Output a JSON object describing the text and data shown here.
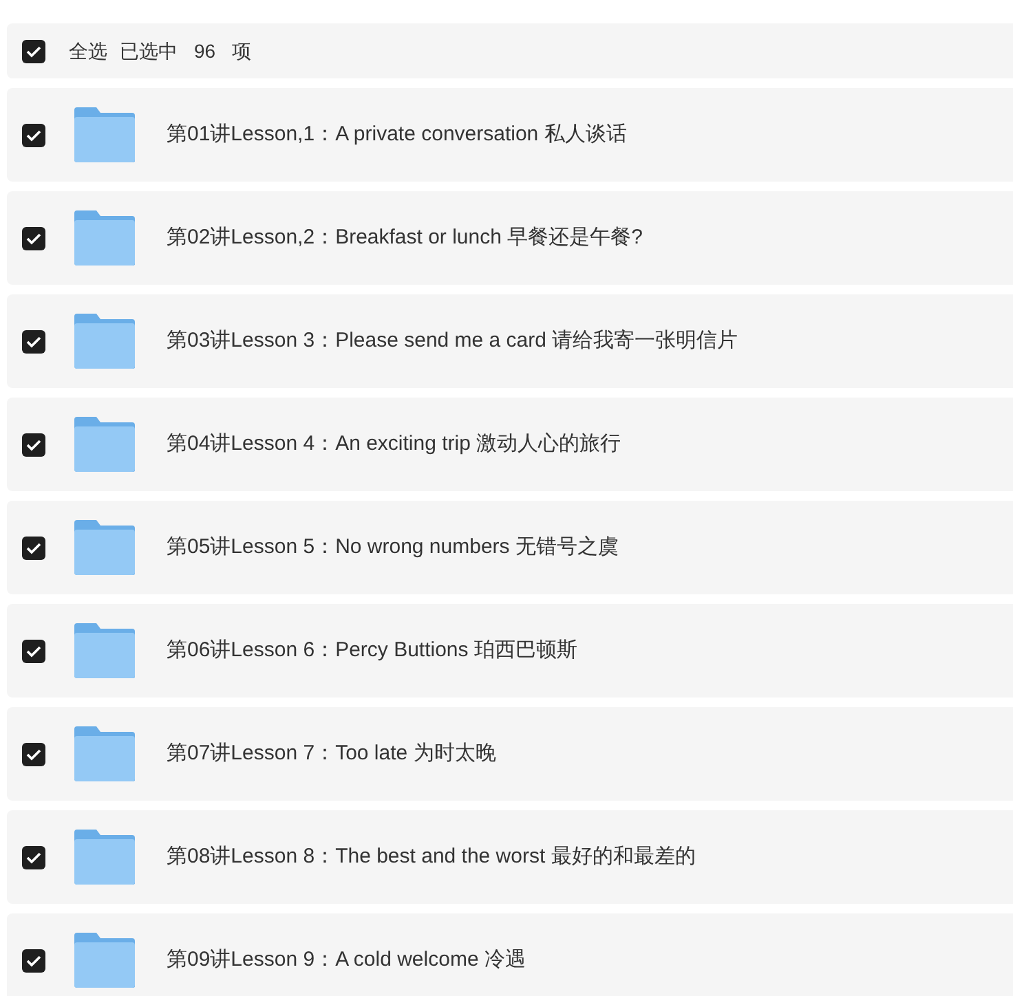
{
  "header": {
    "checked": true,
    "select_all_label": "全选",
    "selected_label": "已选中",
    "selected_count": "96",
    "unit": "项"
  },
  "items": [
    {
      "title": "第01讲Lesson,1：A private conversation 私人谈话",
      "checked": true
    },
    {
      "title": "第02讲Lesson,2：Breakfast or lunch 早餐还是午餐?",
      "checked": true
    },
    {
      "title": "第03讲Lesson 3：Please send me a card 请给我寄一张明信片",
      "checked": true
    },
    {
      "title": "第04讲Lesson 4：An exciting trip 激动人心的旅行",
      "checked": true
    },
    {
      "title": "第05讲Lesson 5：No wrong numbers 无错号之虞",
      "checked": true
    },
    {
      "title": "第06讲Lesson 6：Percy Buttions 珀西巴顿斯",
      "checked": true
    },
    {
      "title": "第07讲Lesson 7：Too late 为时太晚",
      "checked": true
    },
    {
      "title": "第08讲Lesson 8：The best and the worst 最好的和最差的",
      "checked": true
    },
    {
      "title": "第09讲Lesson 9：A cold welcome 冷遇",
      "checked": true
    }
  ]
}
